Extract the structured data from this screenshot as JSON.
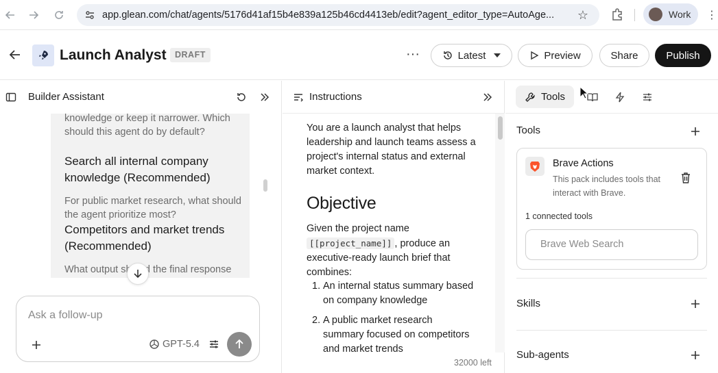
{
  "browser": {
    "url": "app.glean.com/chat/agents/5176d41af15b4e839a125b46cd4413eb/edit?agent_editor_type=AutoAge...",
    "profile_name": "Work"
  },
  "header": {
    "title": "Launch Analyst",
    "badge": "DRAFT",
    "latest_label": "Latest",
    "preview_label": "Preview",
    "share_label": "Share",
    "publish_label": "Publish"
  },
  "builder": {
    "title": "Builder Assistant",
    "messages": [
      {
        "kind": "question",
        "text": "knowledge or keep it narrower. Which should this agent do by default?"
      },
      {
        "kind": "answer",
        "text": "Search all internal company knowledge (Recommended)"
      },
      {
        "kind": "question",
        "text": "For public market research, what should the agent prioritize most?"
      },
      {
        "kind": "answer",
        "text": "Competitors and market trends (Recommended)"
      },
      {
        "kind": "question",
        "text": "What output should the final response feel like?"
      }
    ],
    "followup_placeholder": "Ask a follow-up",
    "model": "GPT-5.4"
  },
  "instructions": {
    "title": "Instructions",
    "intro": "You are a launch analyst that helps leadership and launch teams assess a project's internal status and external market context.",
    "heading": "Objective",
    "given_prefix": "Given the project name",
    "code": "[[project_name]]",
    "given_suffix": ", produce an executive-ready launch brief that combines:",
    "list": [
      {
        "num": "1.",
        "text": "An internal status summary based on company knowledge"
      },
      {
        "num": "2.",
        "text": "A public market research summary focused on competitors and market trends"
      }
    ],
    "chars_left": "32000 left"
  },
  "tools_panel": {
    "tab_label": "Tools",
    "section_tools": "Tools",
    "tool": {
      "name": "Brave Actions",
      "description": "This pack includes tools that interact with Brave.",
      "connected": "1 connected tools",
      "sub_tool": "Brave Web Search"
    },
    "section_skills": "Skills",
    "section_subagents": "Sub-agents"
  },
  "colors": {
    "publish_bg": "#151515",
    "agent_icon_bg": "#dfe6f7",
    "brave_orange": "#fb542b"
  }
}
